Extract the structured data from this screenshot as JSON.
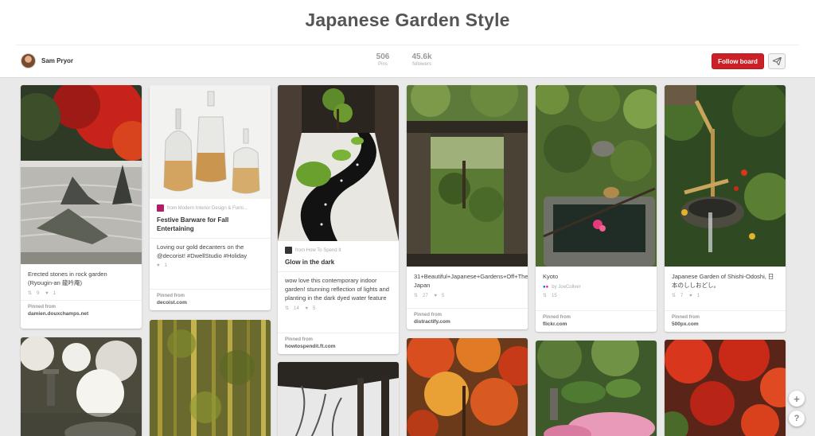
{
  "board": {
    "title": "Japanese Garden Style",
    "owner": "Sam Pryor",
    "stats": [
      {
        "value": "506",
        "label": "Pins"
      },
      {
        "value": "45.6k",
        "label": "followers"
      }
    ],
    "follow_label": "Follow board",
    "send_icon": "paper-plane-icon"
  },
  "pins": [
    {
      "desc": "Erected stones in rock garden (Ryougin-an 龍吟庵)",
      "repins": "9",
      "likes": "1",
      "pinned_from_label": "Pinned from",
      "source": "damien.douxchamps.net"
    },
    {
      "via": "from Modern Interior Design & Furni...",
      "title": "Festive Barware for Fall Entertaining",
      "desc": "Loving our gold decanters on the @decorist! #DwellStudio #Holiday",
      "likes": "1",
      "pinned_from_label": "Pinned from",
      "source": "decoist.com"
    },
    {
      "via": "from How To Spend It",
      "title": "Glow in the dark",
      "desc": "wow love this contemporary indoor garden! stunning reflection of lights and planting in the dark dyed water feature",
      "repins": "14",
      "likes": "5",
      "pinned_from_label": "Pinned from",
      "source": "howtospendit.ft.com"
    },
    {
      "desc": "31+Beautiful+Japanese+Gardens+Off+The+Beaten+Path Japan",
      "repins": "27",
      "likes": "5",
      "pinned_from_label": "Pinned from",
      "source": "distractify.com"
    },
    {
      "desc": "Kyoto",
      "user": "by JoeCollver",
      "repins": "15",
      "pinned_from_label": "Pinned from",
      "source": "flickr.com"
    },
    {
      "desc": "Japanese Garden of Shishi-Odoshi, 日本のししおどし。",
      "repins": "7",
      "likes": "1",
      "pinned_from_label": "Pinned from",
      "source": "500px.com"
    }
  ],
  "floating": {
    "add_label": "+",
    "help_label": "?"
  }
}
